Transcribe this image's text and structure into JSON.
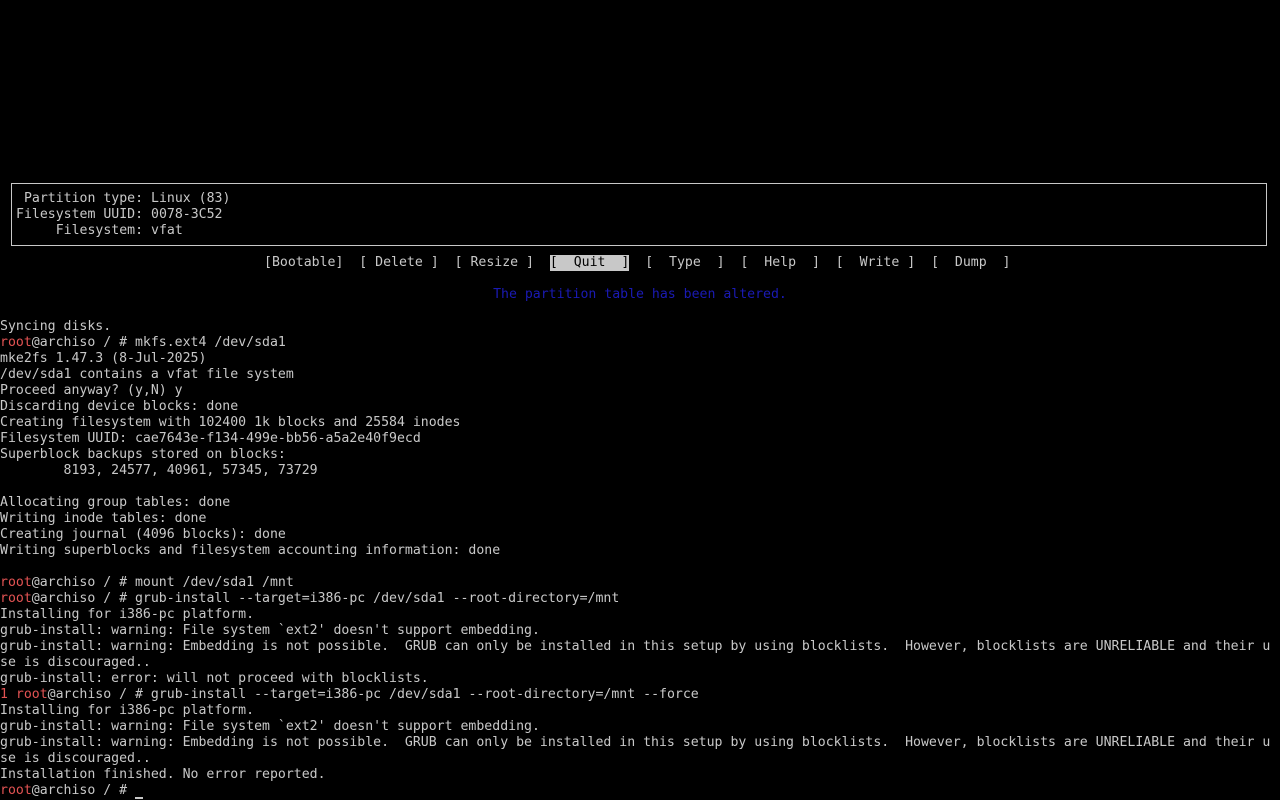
{
  "partition_info": {
    "type_label": " Partition type:",
    "type_value": "Linux (83)",
    "uuid_label": "Filesystem UUID:",
    "uuid_value": "0078-3C52",
    "fs_label": "     Filesystem:",
    "fs_value": "vfat"
  },
  "menu": {
    "items": [
      "[Bootable]",
      "[ Delete ]",
      "[ Resize ]",
      "[  Quit  ]",
      "[  Type  ]",
      "[  Help  ]",
      "[  Write ]",
      "[  Dump  ]"
    ],
    "selected": "[  Quit  ]"
  },
  "status_message": "The partition table has been altered.",
  "prompt": {
    "user": "root",
    "host_path": "@archiso / # "
  },
  "terminal": {
    "line01": "Syncing disks.",
    "cmd01": "mkfs.ext4 /dev/sda1",
    "line02": "mke2fs 1.47.3 (8-Jul-2025)",
    "line03": "/dev/sda1 contains a vfat file system",
    "line04": "Proceed anyway? (y,N) y",
    "line05": "Discarding device blocks: done",
    "line06": "Creating filesystem with 102400 1k blocks and 25584 inodes",
    "line07": "Filesystem UUID: cae7643e-f134-499e-bb56-a5a2e40f9ecd",
    "line08": "Superblock backups stored on blocks:",
    "line09": "        8193, 24577, 40961, 57345, 73729",
    "line10": "Allocating group tables: done",
    "line11": "Writing inode tables: done",
    "line12": "Creating journal (4096 blocks): done",
    "line13": "Writing superblocks and filesystem accounting information: done",
    "cmd02": "mount /dev/sda1 /mnt",
    "cmd03": "grub-install --target=i386-pc /dev/sda1 --root-directory=/mnt",
    "line14": "Installing for i386-pc platform.",
    "line15": "grub-install: warning: File system `ext2' doesn't support embedding.",
    "line16": "grub-install: warning: Embedding is not possible.  GRUB can only be installed in this setup by using blocklists.  However, blocklists are UNRELIABLE and their u",
    "line17": "se is discouraged..",
    "line18": "grub-install: error: will not proceed with blocklists.",
    "exit_code": "1 ",
    "cmd04": "grub-install --target=i386-pc /dev/sda1 --root-directory=/mnt --force",
    "line19": "Installing for i386-pc platform.",
    "line20": "grub-install: warning: File system `ext2' doesn't support embedding.",
    "line21": "grub-install: warning: Embedding is not possible.  GRUB can only be installed in this setup by using blocklists.  However, blocklists are UNRELIABLE and their u",
    "line22": "se is discouraged..",
    "line23": "Installation finished. No error reported."
  },
  "colors": {
    "background": "#000000",
    "foreground": "#c8c8c8",
    "prompt_user": "#e35353",
    "status_message": "#1a1ab4"
  }
}
